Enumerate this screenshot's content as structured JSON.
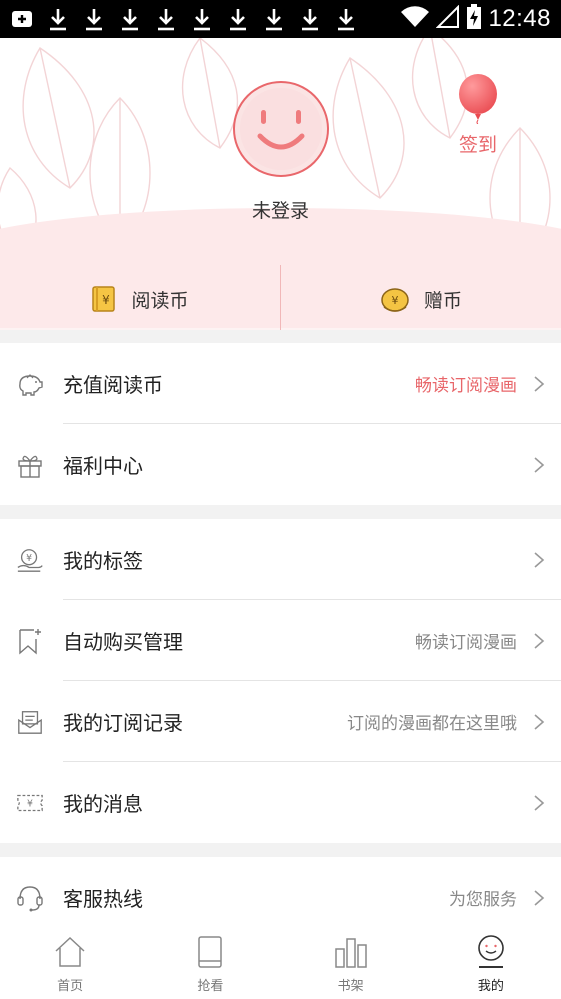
{
  "status_bar": {
    "time": "12:48"
  },
  "profile": {
    "login_label": "未登录",
    "checkin_label": "签到"
  },
  "currency": {
    "read_coin": "阅读币",
    "gift_coin": "赠币"
  },
  "section1": [
    {
      "label": "充值阅读币",
      "value": "畅读订阅漫画",
      "icon": "piggy-bank-icon"
    },
    {
      "label": "福利中心",
      "value": "",
      "icon": "gift-icon"
    }
  ],
  "section2": [
    {
      "label": "我的标签",
      "value": "",
      "icon": "yen-hand-icon"
    },
    {
      "label": "自动购买管理",
      "value": "畅读订阅漫画",
      "icon": "bookmark-star-icon"
    },
    {
      "label": "我的订阅记录",
      "value": "订阅的漫画都在这里哦",
      "icon": "envelope-icon"
    },
    {
      "label": "我的消息",
      "value": "",
      "icon": "coupon-icon"
    }
  ],
  "section3": [
    {
      "label": "客服热线",
      "value": "为您服务",
      "icon": "headset-icon"
    }
  ],
  "tabs": [
    {
      "label": "首页",
      "icon": "home-icon"
    },
    {
      "label": "抢看",
      "icon": "book-icon"
    },
    {
      "label": "书架",
      "icon": "bookshelf-icon"
    },
    {
      "label": "我的",
      "icon": "smiley-icon",
      "active": true
    }
  ],
  "colors": {
    "accent": "#e8666a",
    "header_pink": "#fde9ea"
  }
}
